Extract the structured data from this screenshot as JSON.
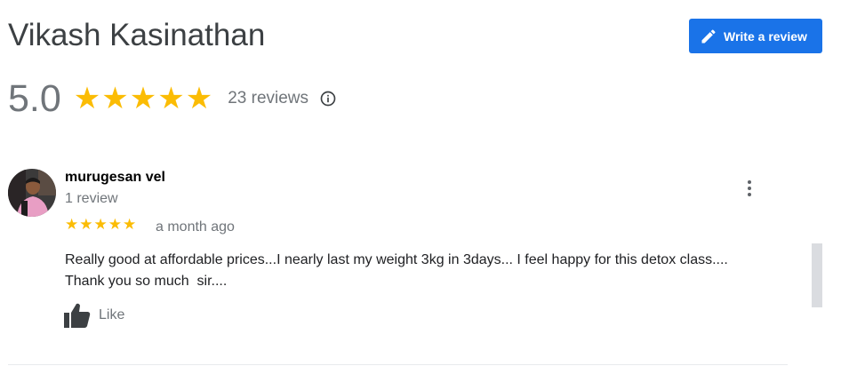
{
  "header": {
    "title": "Vikash Kasinathan",
    "write_review_label": "Write a review",
    "write_review_icon": "pencil-icon"
  },
  "summary": {
    "rating": "5.0",
    "stars": 5,
    "review_count_text": "23 reviews",
    "info_icon": "info-icon"
  },
  "review": {
    "author": "murugesan vel",
    "author_meta": "1 review",
    "stars": 5,
    "time": "a month ago",
    "text": "Really good at affordable prices...I nearly last my weight 3kg in 3days... I feel happy for this detox class.... Thank you so much  sir....",
    "like_label": "Like",
    "like_icon": "thumbs-up-icon",
    "more_icon": "more-vert-icon"
  },
  "colors": {
    "accent": "#1a73e8",
    "star": "#fbbc04",
    "muted_text": "#70757a"
  }
}
